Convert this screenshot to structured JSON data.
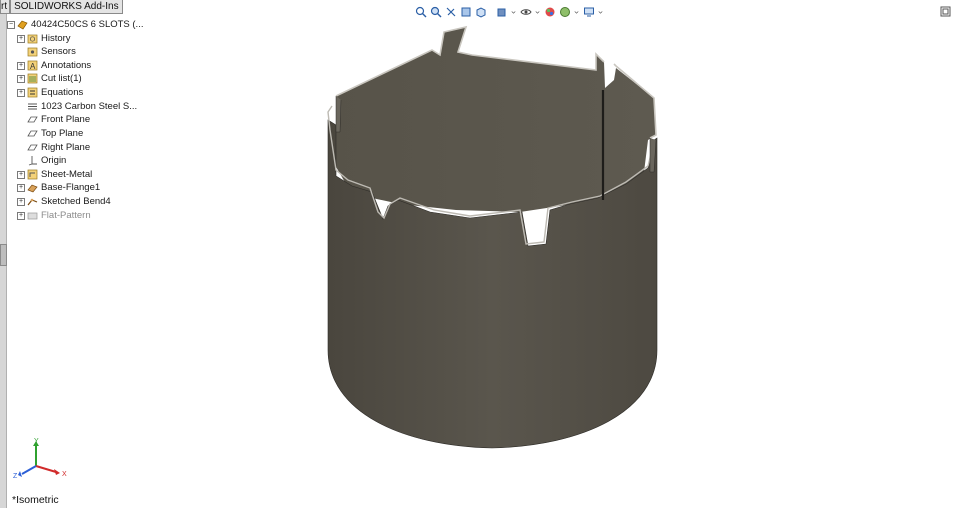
{
  "tabs": {
    "partial_tab": "rt",
    "addins_tab": "SOLIDWORKS Add-Ins"
  },
  "tree": {
    "root": "40424C50CS 6 SLOTS  (...",
    "items": [
      {
        "label": "History",
        "icon": "history-folder-icon"
      },
      {
        "label": "Sensors",
        "icon": "sensors-folder-icon"
      },
      {
        "label": "Annotations",
        "icon": "annotations-icon"
      },
      {
        "label": "Cut list(1)",
        "icon": "cut-list-icon"
      },
      {
        "label": "Equations",
        "icon": "equations-icon"
      },
      {
        "label": "1023 Carbon Steel S...",
        "icon": "material-icon"
      },
      {
        "label": "Front Plane",
        "icon": "plane-icon"
      },
      {
        "label": "Top Plane",
        "icon": "plane-icon"
      },
      {
        "label": "Right Plane",
        "icon": "plane-icon"
      },
      {
        "label": "Origin",
        "icon": "origin-icon"
      },
      {
        "label": "Sheet-Metal",
        "icon": "sheet-metal-icon"
      },
      {
        "label": "Base-Flange1",
        "icon": "base-flange-icon"
      },
      {
        "label": "Sketched Bend4",
        "icon": "sketched-bend-icon"
      },
      {
        "label": "Flat-Pattern",
        "icon": "flat-pattern-icon"
      }
    ]
  },
  "view": {
    "orientation": "*Isometric",
    "triad_labels": {
      "y": "Y",
      "x": "X",
      "z": "Z"
    }
  },
  "colors": {
    "part_body": "#555148",
    "part_edge": "#2e2c28",
    "triad_x": "#d12a2a",
    "triad_y": "#2fa12f",
    "triad_z": "#2c5fd6"
  }
}
